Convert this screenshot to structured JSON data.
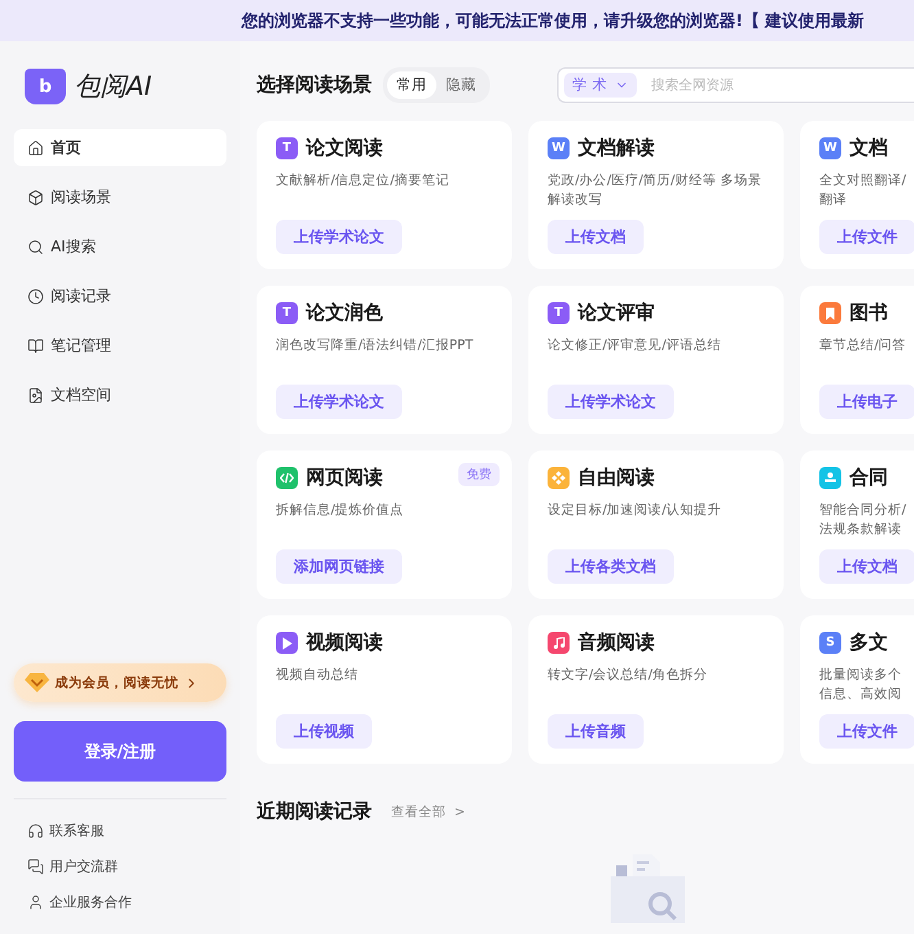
{
  "banner": {
    "text": "您的浏览器不支持一些功能，可能无法正常使用，请升级您的浏览器!【 建议使用最新"
  },
  "sidebar": {
    "logo": {
      "letter": "b",
      "name": "包阅AI"
    },
    "items": [
      {
        "label": "首页",
        "kind": "home",
        "selected": true
      },
      {
        "label": "阅读场景",
        "kind": "cube",
        "selected": false
      },
      {
        "label": "AI搜索",
        "kind": "search",
        "selected": false
      },
      {
        "label": "阅读记录",
        "kind": "clock",
        "selected": false
      },
      {
        "label": "笔记管理",
        "kind": "book",
        "selected": false
      },
      {
        "label": "文档空间",
        "kind": "file",
        "selected": false
      }
    ],
    "member": {
      "label": "成为会员，阅读无忧"
    },
    "login": {
      "label": "登录/注册"
    },
    "footer_links": [
      {
        "label": "联系客服",
        "kind": "headset"
      },
      {
        "label": "用户交流群",
        "kind": "chat"
      },
      {
        "label": "企业服务合作",
        "kind": "user"
      }
    ]
  },
  "scenes": {
    "title": "选择阅读场景",
    "tabs": [
      {
        "label": "常用",
        "selected": true
      },
      {
        "label": "隐藏",
        "selected": false
      }
    ],
    "search": {
      "scope": "学 术",
      "placeholder": "搜索全网资源"
    },
    "cards": [
      {
        "title": "论文阅读",
        "kind": "letter",
        "glyph": "T",
        "color": "#8b5cf6",
        "desc": [
          "文献解析/信息定位/摘要笔记"
        ],
        "button": "上传学术论文"
      },
      {
        "title": "文档解读",
        "kind": "letter",
        "glyph": "W",
        "color": "#5b80f7",
        "desc": [
          "党政/办公/医疗/简历/财经等 多场景",
          "解读改写"
        ],
        "button": "上传文档"
      },
      {
        "title": "文档",
        "kind": "letter",
        "glyph": "W",
        "color": "#5b80f7",
        "desc": [
          "全文对照翻译/",
          "翻译"
        ],
        "button": "上传文件"
      },
      {
        "title": "论文润色",
        "kind": "letter",
        "glyph": "T",
        "color": "#8b5cf6",
        "desc": [
          "润色改写降重/语法纠错/汇报PPT"
        ],
        "button": "上传学术论文"
      },
      {
        "title": "论文评审",
        "kind": "letter",
        "glyph": "T",
        "color": "#8b5cf6",
        "desc": [
          "论文修正/评审意见/评语总结"
        ],
        "button": "上传学术论文"
      },
      {
        "title": "图书",
        "kind": "bookmark",
        "color": "#fb7a3c",
        "desc": [
          "章节总结/问答"
        ],
        "button": "上传电子"
      },
      {
        "title": "网页阅读",
        "kind": "code",
        "color": "#1fc16b",
        "desc": [
          "拆解信息/提炼价值点"
        ],
        "button": "添加网页链接",
        "badge": "免费"
      },
      {
        "title": "自由阅读",
        "kind": "diamond",
        "color": "#fbb33a",
        "desc": [
          "设定目标/加速阅读/认知提升"
        ],
        "button": "上传各类文档"
      },
      {
        "title": "合同",
        "kind": "stamp",
        "color": "#14c3e6",
        "desc": [
          "智能合同分析/",
          "法规条款解读"
        ],
        "button": "上传文档"
      },
      {
        "title": "视频阅读",
        "kind": "play",
        "color": "#8b5cf6",
        "desc": [
          "视频自动总结"
        ],
        "button": "上传视频"
      },
      {
        "title": "音频阅读",
        "kind": "music",
        "color": "#f5476e",
        "desc": [
          "转文字/会议总结/角色拆分"
        ],
        "button": "上传音频"
      },
      {
        "title": "多文",
        "kind": "letter",
        "glyph": "S",
        "color": "#5b80f7",
        "desc": [
          "批量阅读多个",
          "信息、高效阅"
        ],
        "button": "上传文件"
      }
    ]
  },
  "recent": {
    "title": "近期阅读记录",
    "link": "查看全部",
    "link_arrow": ">"
  }
}
